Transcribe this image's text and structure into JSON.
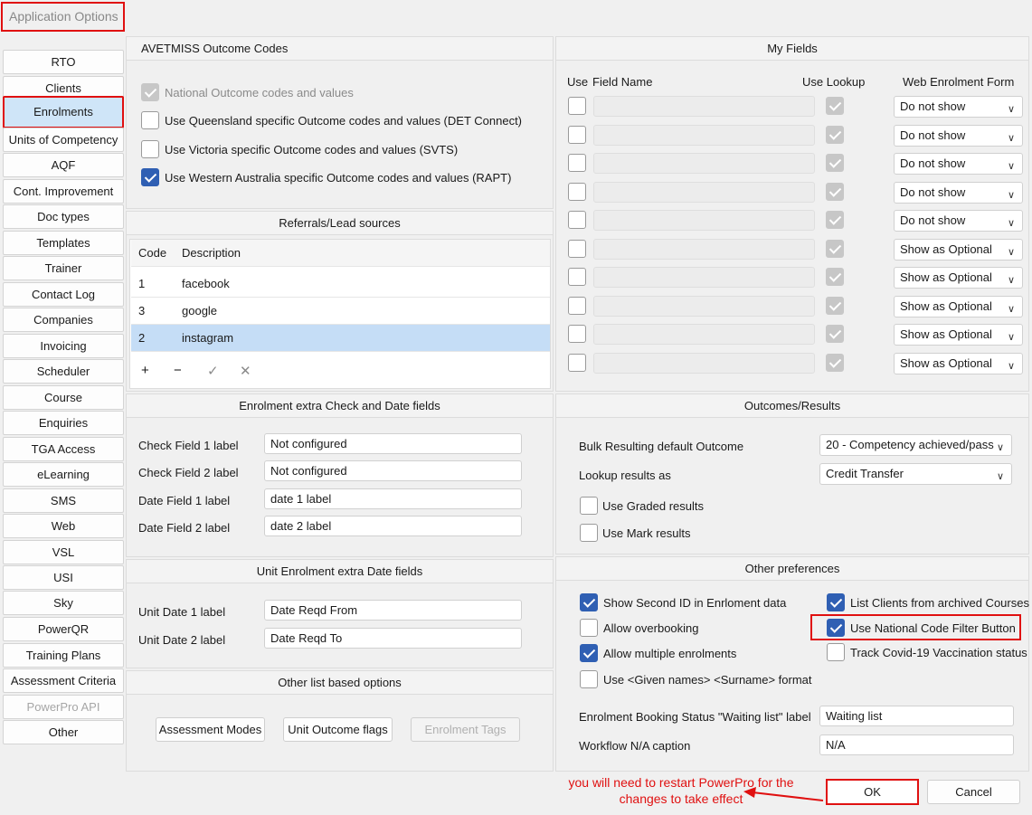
{
  "window": {
    "title": "Application Options"
  },
  "sidebar": {
    "items": [
      {
        "label": "RTO"
      },
      {
        "label": "Clients"
      },
      {
        "label": "Enrolments"
      },
      {
        "label": "Units of Competency"
      },
      {
        "label": "AQF"
      },
      {
        "label": "Cont. Improvement"
      },
      {
        "label": "Doc types"
      },
      {
        "label": "Templates"
      },
      {
        "label": "Trainer"
      },
      {
        "label": "Contact Log"
      },
      {
        "label": "Companies"
      },
      {
        "label": "Invoicing"
      },
      {
        "label": "Scheduler"
      },
      {
        "label": "Course"
      },
      {
        "label": "Enquiries"
      },
      {
        "label": "TGA Access"
      },
      {
        "label": "eLearning"
      },
      {
        "label": "SMS"
      },
      {
        "label": "Web"
      },
      {
        "label": "VSL"
      },
      {
        "label": "USI"
      },
      {
        "label": "Sky"
      },
      {
        "label": "PowerQR"
      },
      {
        "label": "Training Plans"
      },
      {
        "label": "Assessment Criteria"
      },
      {
        "label": "PowerPro API"
      },
      {
        "label": "Other"
      }
    ],
    "active": "Enrolments",
    "disabled": "PowerPro API"
  },
  "avetmiss": {
    "title": "AVETMISS Outcome Codes",
    "options": [
      {
        "label": "National Outcome codes and values",
        "state": "disabled-checked"
      },
      {
        "label": "Use Queensland specific Outcome codes and values (DET Connect)",
        "state": "unchecked"
      },
      {
        "label": "Use Victoria specific Outcome codes and values (SVTS)",
        "state": "unchecked"
      },
      {
        "label": "Use Western Australia specific Outcome codes and values (RAPT)",
        "state": "checked"
      }
    ]
  },
  "referrals": {
    "title": "Referrals/Lead sources",
    "columns": [
      "Code",
      "Description"
    ],
    "rows": [
      {
        "code": "1",
        "description": "facebook"
      },
      {
        "code": "3",
        "description": "google"
      },
      {
        "code": "2",
        "description": "instagram"
      }
    ],
    "selected_row": 2,
    "toolbar": {
      "add": "+",
      "remove": "−",
      "confirm": "✓",
      "cancel": "✕"
    }
  },
  "extra_fields": {
    "title": "Enrolment extra Check and Date fields",
    "rows": [
      {
        "label": "Check Field 1  label",
        "value": "Not configured"
      },
      {
        "label": "Check Field 2 label",
        "value": "Not configured"
      },
      {
        "label": "Date Field 1 label",
        "value": "date 1 label"
      },
      {
        "label": "Date Field 2 label",
        "value": "date 2 label"
      }
    ]
  },
  "unit_dates": {
    "title": "Unit Enrolment extra Date fields",
    "rows": [
      {
        "label": "Unit Date 1 label",
        "value": "Date Reqd From"
      },
      {
        "label": "Unit Date 2 label",
        "value": "Date Reqd To"
      }
    ]
  },
  "other_lists": {
    "title": "Other list based options",
    "buttons": [
      "Assessment Modes",
      "Unit Outcome flags",
      "Enrolment Tags"
    ]
  },
  "my_fields": {
    "title": "My Fields",
    "columns": {
      "use": "Use",
      "field_name": "Field Name",
      "use_lookup": "Use Lookup",
      "web_form": "Web Enrolment Form"
    },
    "rows": [
      {
        "web": "Do not show"
      },
      {
        "web": "Do not show"
      },
      {
        "web": "Do not show"
      },
      {
        "web": "Do not show"
      },
      {
        "web": "Do not show"
      },
      {
        "web": "Show as Optional"
      },
      {
        "web": "Show as Optional"
      },
      {
        "web": "Show as Optional"
      },
      {
        "web": "Show as Optional"
      },
      {
        "web": "Show as Optional"
      }
    ]
  },
  "outcomes": {
    "title": "Outcomes/Results",
    "bulk_label": "Bulk Resulting default Outcome",
    "bulk_value": "20 - Competency achieved/pass",
    "lookup_label": "Lookup results as",
    "lookup_value": "Credit Transfer",
    "graded_label": "Use Graded results",
    "mark_label": "Use Mark results"
  },
  "other_prefs": {
    "title": "Other preferences",
    "left": [
      {
        "label": "Show Second ID in Enrloment data",
        "checked": true
      },
      {
        "label": "Allow overbooking",
        "checked": false
      },
      {
        "label": "Allow multiple enrolments",
        "checked": true
      },
      {
        "label": "Use <Given names> <Surname> format",
        "checked": false
      }
    ],
    "right": [
      {
        "label": "List Clients from archived Courses",
        "checked": true
      },
      {
        "label": "Use National Code Filter Button",
        "checked": true
      },
      {
        "label": "Track Covid-19 Vaccination status",
        "checked": false
      }
    ],
    "waiting_label": "Enrolment Booking Status \"Waiting list\" label",
    "waiting_value": "Waiting list",
    "workflow_label": "Workflow N/A caption",
    "workflow_value": "N/A"
  },
  "footer": {
    "note_line1": "you will need to restart PowerPro for the",
    "note_line2": "changes to take effect",
    "ok": "OK",
    "cancel": "Cancel"
  },
  "colors": {
    "accent": "#2f5fb3",
    "highlight": "#e01010",
    "selected": "#c5ddf6"
  }
}
